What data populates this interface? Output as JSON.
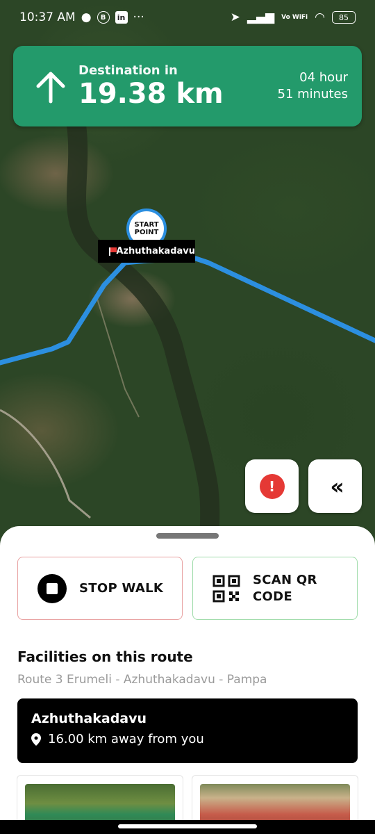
{
  "status_bar": {
    "time": "10:37 AM",
    "network": "Vo WiFi",
    "battery": "85"
  },
  "navigation": {
    "label": "Destination in",
    "distance": "19.38 km",
    "eta_hours": "04 hour",
    "eta_minutes": "51 minutes",
    "color": "#239a6b"
  },
  "map": {
    "marker_label": "START POINT",
    "place_tag": "Azhuthakadavu",
    "route_color": "#2c8fe0"
  },
  "actions": {
    "stop_walk": "STOP WALK",
    "scan_qr": "SCAN QR CODE"
  },
  "facilities": {
    "title": "Facilities on this route",
    "route_name": "Route 3 Erumeli - Azhuthakadavu - Pampa",
    "location": {
      "name": "Azhuthakadavu",
      "distance": "16.00 km away from you"
    }
  }
}
